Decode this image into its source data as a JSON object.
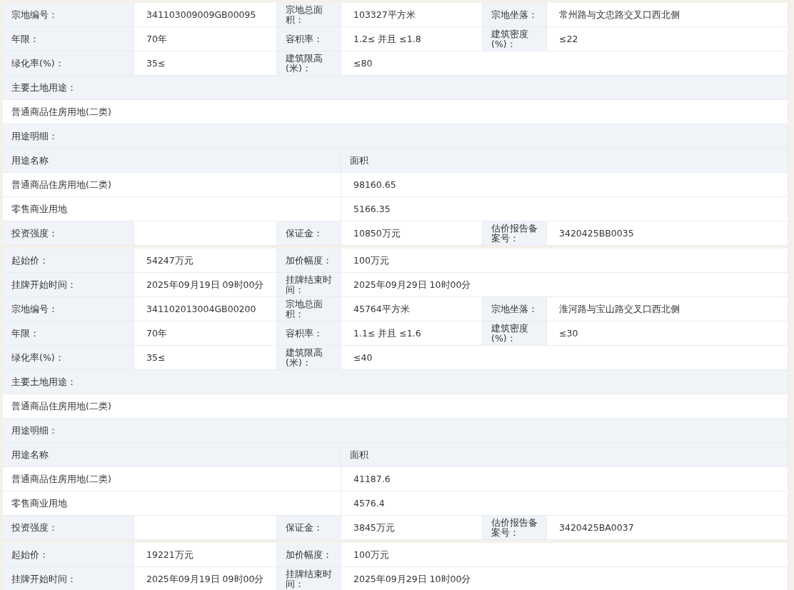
{
  "parcels": [
    {
      "info_rows": [
        [
          {
            "label": "宗地编号：",
            "value": "341103009009GB00095"
          },
          {
            "label": "宗地总面积：",
            "value": "103327平方米"
          },
          {
            "label": "宗地坐落：",
            "value": "常州路与文忠路交叉口西北侧"
          }
        ],
        [
          {
            "label": "年限：",
            "value": "70年"
          },
          {
            "label": "容积率：",
            "value": "1.2≤ 并且 ≤1.8"
          },
          {
            "label": "建筑密度(%)：",
            "value": "≤22"
          }
        ],
        [
          {
            "label": "绿化率(%)：",
            "value": "35≤"
          },
          {
            "label": "建筑限高(米)：",
            "value": "≤80"
          }
        ]
      ],
      "main_use_label": "主要土地用途：",
      "main_use": "普通商品住房用地(二类)",
      "detail_label": "用途明细：",
      "detail_columns": [
        "用途名称",
        "面积"
      ],
      "detail_rows": [
        [
          "普通商品住房用地(二类)",
          "98160.65"
        ],
        [
          "零售商业用地",
          "5166.35"
        ]
      ],
      "finance_row": [
        {
          "label": "投资强度："
        },
        {
          "label": "保证金：",
          "value": "10850万元"
        },
        {
          "label": "估价报告备案号：",
          "value": "3420425BB0035"
        }
      ],
      "auction_rows": [
        [
          {
            "label": "起始价：",
            "value": "54247万元"
          },
          {
            "label": "加价幅度：",
            "value": "100万元"
          }
        ],
        [
          {
            "label": "挂牌开始时间：",
            "value": "2025年09月19日 09时00分"
          },
          {
            "label": "挂牌结束时间：",
            "value": "2025年09月29日 10时00分"
          }
        ]
      ]
    },
    {
      "info_rows": [
        [
          {
            "label": "宗地编号：",
            "value": "341102013004GB00200"
          },
          {
            "label": "宗地总面积：",
            "value": "45764平方米"
          },
          {
            "label": "宗地坐落：",
            "value": "淮河路与宝山路交叉口西北侧"
          }
        ],
        [
          {
            "label": "年限：",
            "value": "70年"
          },
          {
            "label": "容积率：",
            "value": "1.1≤ 并且 ≤1.6"
          },
          {
            "label": "建筑密度(%)：",
            "value": "≤30"
          }
        ],
        [
          {
            "label": "绿化率(%)：",
            "value": "35≤"
          },
          {
            "label": "建筑限高(米)：",
            "value": "≤40"
          }
        ]
      ],
      "main_use_label": "主要土地用途：",
      "main_use": "普通商品住房用地(二类)",
      "detail_label": "用途明细：",
      "detail_columns": [
        "用途名称",
        "面积"
      ],
      "detail_rows": [
        [
          "普通商品住房用地(二类)",
          "41187.6"
        ],
        [
          "零售商业用地",
          "4576.4"
        ]
      ],
      "finance_row": [
        {
          "label": "投资强度："
        },
        {
          "label": "保证金：",
          "value": "3845万元"
        },
        {
          "label": "估价报告备案号：",
          "value": "3420425BA0037"
        }
      ],
      "auction_rows": [
        [
          {
            "label": "起始价：",
            "value": "19221万元"
          },
          {
            "label": "加价幅度：",
            "value": "100万元"
          }
        ],
        [
          {
            "label": "挂牌开始时间：",
            "value": "2025年09月19日 09时00分"
          },
          {
            "label": "挂牌结束时间：",
            "value": "2025年09月29日 10时00分"
          }
        ]
      ]
    }
  ]
}
